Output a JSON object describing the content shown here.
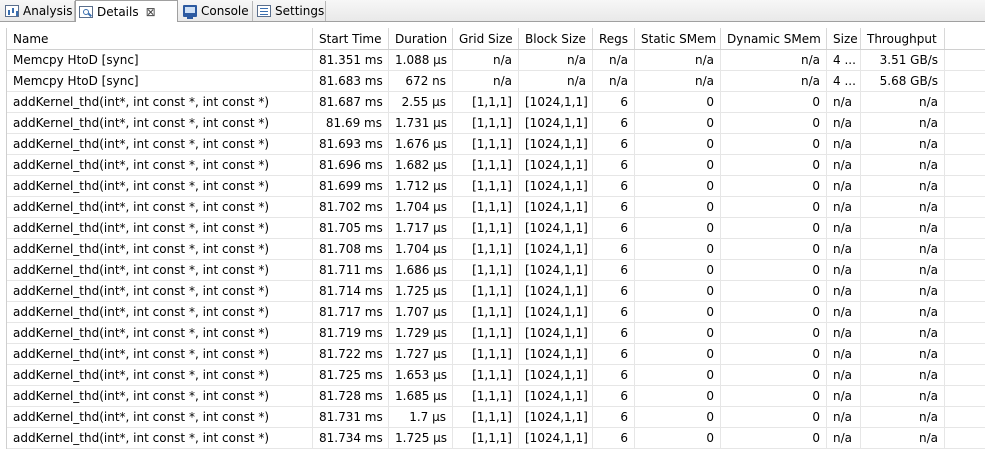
{
  "tabs": [
    {
      "label": "Analysis",
      "icon": "analysis-icon"
    },
    {
      "label": "Details",
      "icon": "details-icon",
      "active": true,
      "close": "⊠"
    },
    {
      "label": "Console",
      "icon": "console-icon"
    },
    {
      "label": "Settings",
      "icon": "settings-icon"
    }
  ],
  "table": {
    "columns": [
      "Name",
      "Start Time",
      "Duration",
      "Grid Size",
      "Block Size",
      "Regs",
      "Static SMem",
      "Dynamic SMem",
      "Size",
      "Throughput"
    ],
    "rows": [
      [
        "Memcpy HtoD [sync]",
        "81.351 ms",
        "1.088 µs",
        "n/a",
        "n/a",
        "n/a",
        "n/a",
        "n/a",
        "4 ...",
        "3.51 GB/s"
      ],
      [
        "Memcpy HtoD [sync]",
        "81.683 ms",
        "672 ns",
        "n/a",
        "n/a",
        "n/a",
        "n/a",
        "n/a",
        "4 ...",
        "5.68 GB/s"
      ],
      [
        "addKernel_thd(int*, int const *, int const *)",
        "81.687 ms",
        "2.55 µs",
        "[1,1,1]",
        "[1024,1,1]",
        "6",
        "0",
        "0",
        "n/a",
        "n/a"
      ],
      [
        "addKernel_thd(int*, int const *, int const *)",
        "81.69 ms",
        "1.731 µs",
        "[1,1,1]",
        "[1024,1,1]",
        "6",
        "0",
        "0",
        "n/a",
        "n/a"
      ],
      [
        "addKernel_thd(int*, int const *, int const *)",
        "81.693 ms",
        "1.676 µs",
        "[1,1,1]",
        "[1024,1,1]",
        "6",
        "0",
        "0",
        "n/a",
        "n/a"
      ],
      [
        "addKernel_thd(int*, int const *, int const *)",
        "81.696 ms",
        "1.682 µs",
        "[1,1,1]",
        "[1024,1,1]",
        "6",
        "0",
        "0",
        "n/a",
        "n/a"
      ],
      [
        "addKernel_thd(int*, int const *, int const *)",
        "81.699 ms",
        "1.712 µs",
        "[1,1,1]",
        "[1024,1,1]",
        "6",
        "0",
        "0",
        "n/a",
        "n/a"
      ],
      [
        "addKernel_thd(int*, int const *, int const *)",
        "81.702 ms",
        "1.704 µs",
        "[1,1,1]",
        "[1024,1,1]",
        "6",
        "0",
        "0",
        "n/a",
        "n/a"
      ],
      [
        "addKernel_thd(int*, int const *, int const *)",
        "81.705 ms",
        "1.717 µs",
        "[1,1,1]",
        "[1024,1,1]",
        "6",
        "0",
        "0",
        "n/a",
        "n/a"
      ],
      [
        "addKernel_thd(int*, int const *, int const *)",
        "81.708 ms",
        "1.704 µs",
        "[1,1,1]",
        "[1024,1,1]",
        "6",
        "0",
        "0",
        "n/a",
        "n/a"
      ],
      [
        "addKernel_thd(int*, int const *, int const *)",
        "81.711 ms",
        "1.686 µs",
        "[1,1,1]",
        "[1024,1,1]",
        "6",
        "0",
        "0",
        "n/a",
        "n/a"
      ],
      [
        "addKernel_thd(int*, int const *, int const *)",
        "81.714 ms",
        "1.725 µs",
        "[1,1,1]",
        "[1024,1,1]",
        "6",
        "0",
        "0",
        "n/a",
        "n/a"
      ],
      [
        "addKernel_thd(int*, int const *, int const *)",
        "81.717 ms",
        "1.707 µs",
        "[1,1,1]",
        "[1024,1,1]",
        "6",
        "0",
        "0",
        "n/a",
        "n/a"
      ],
      [
        "addKernel_thd(int*, int const *, int const *)",
        "81.719 ms",
        "1.729 µs",
        "[1,1,1]",
        "[1024,1,1]",
        "6",
        "0",
        "0",
        "n/a",
        "n/a"
      ],
      [
        "addKernel_thd(int*, int const *, int const *)",
        "81.722 ms",
        "1.727 µs",
        "[1,1,1]",
        "[1024,1,1]",
        "6",
        "0",
        "0",
        "n/a",
        "n/a"
      ],
      [
        "addKernel_thd(int*, int const *, int const *)",
        "81.725 ms",
        "1.653 µs",
        "[1,1,1]",
        "[1024,1,1]",
        "6",
        "0",
        "0",
        "n/a",
        "n/a"
      ],
      [
        "addKernel_thd(int*, int const *, int const *)",
        "81.728 ms",
        "1.685 µs",
        "[1,1,1]",
        "[1024,1,1]",
        "6",
        "0",
        "0",
        "n/a",
        "n/a"
      ],
      [
        "addKernel_thd(int*, int const *, int const *)",
        "81.731 ms",
        "1.7 µs",
        "[1,1,1]",
        "[1024,1,1]",
        "6",
        "0",
        "0",
        "n/a",
        "n/a"
      ],
      [
        "addKernel_thd(int*, int const *, int const *)",
        "81.734 ms",
        "1.725 µs",
        "[1,1,1]",
        "[1024,1,1]",
        "6",
        "0",
        "0",
        "n/a",
        "n/a"
      ]
    ]
  }
}
